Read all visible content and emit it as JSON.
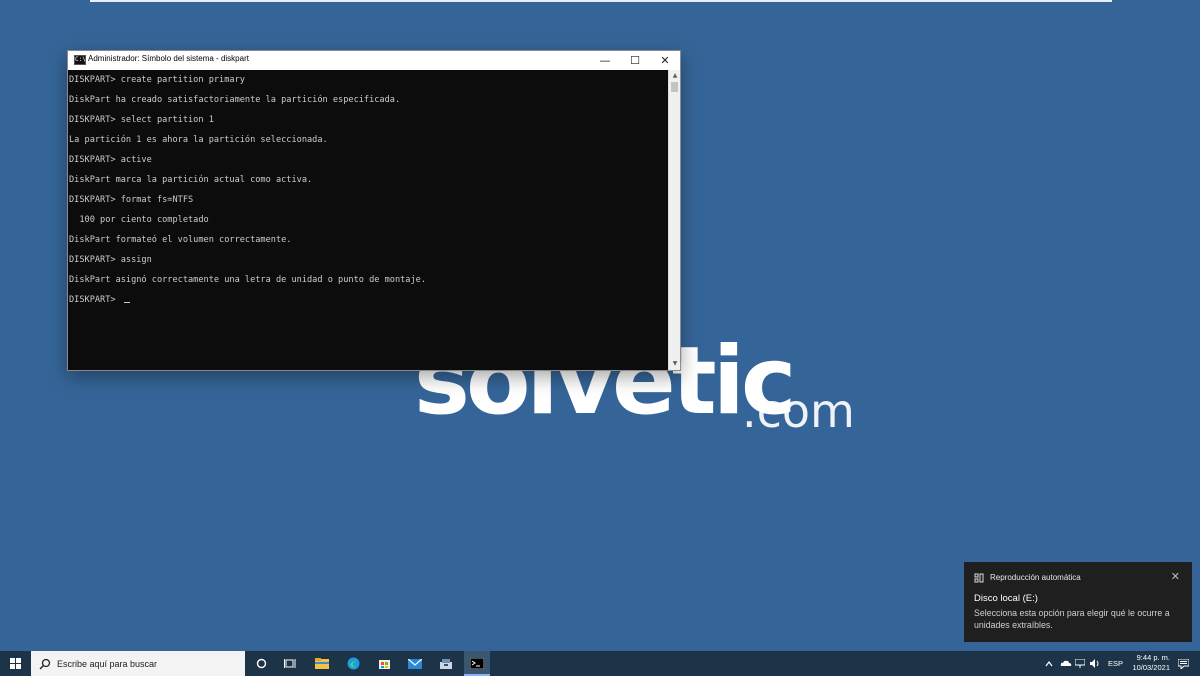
{
  "window": {
    "title": "Administrador: Símbolo del sistema - diskpart",
    "icon": "console-icon",
    "controls": {
      "minimize": "—",
      "maximize": "☐",
      "close": "✕"
    }
  },
  "console": {
    "lines": [
      "DISKPART> create partition primary",
      "DiskPart ha creado satisfactoriamente la partición especificada.",
      "DISKPART> select partition 1",
      "La partición 1 es ahora la partición seleccionada.",
      "DISKPART> active",
      "DiskPart marca la partición actual como activa.",
      "DISKPART> format fs=NTFS",
      "  100 por ciento completado",
      "DiskPart formateó el volumen correctamente.",
      "DISKPART> assign",
      "DiskPart asignó correctamente una letra de unidad o punto de montaje.",
      "DISKPART> "
    ]
  },
  "watermark": {
    "brand": "solvetic",
    "tld": ".com"
  },
  "toast": {
    "app": "Reproducción automática",
    "title": "Disco local (E:)",
    "body": "Selecciona esta opción para elegir qué le ocurre a unidades extraíbles.",
    "close": "✕"
  },
  "taskbar": {
    "search_placeholder": "Escribe aquí para buscar",
    "pinned_icons": [
      "task-view-icon",
      "file-explorer-icon",
      "edge-icon",
      "store-icon",
      "mail-icon",
      "app-installer-icon",
      "command-prompt-icon"
    ],
    "tray": {
      "language": "ESP",
      "time": "9:44 p. m.",
      "date": "10/03/2021"
    }
  },
  "colors": {
    "desktop": "#356598",
    "console_bg": "#0c0c0c",
    "taskbar": "#1d3347",
    "toast": "#1f1f1f"
  }
}
